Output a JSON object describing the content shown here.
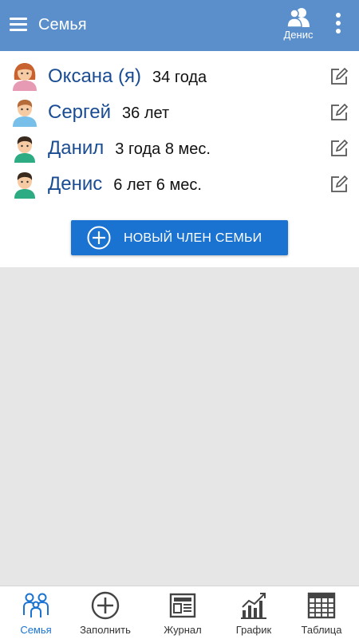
{
  "appbar": {
    "title": "Семья",
    "current_user": "Денис"
  },
  "members": [
    {
      "name": "Оксана (я)",
      "age": "34 года",
      "avatar": "woman-avatar"
    },
    {
      "name": "Сергей",
      "age": "36 лет",
      "avatar": "man-avatar"
    },
    {
      "name": "Данил",
      "age": "3 года 8 мес.",
      "avatar": "boy-avatar"
    },
    {
      "name": "Денис",
      "age": "6 лет 6 мес.",
      "avatar": "boy-avatar"
    }
  ],
  "add_member_label": "НОВЫЙ ЧЛЕН СЕМЬИ",
  "nav": [
    {
      "label": "Семья",
      "icon": "family-icon",
      "active": true
    },
    {
      "label": "Заполнить",
      "icon": "plus-circle-icon"
    },
    {
      "label": "Журнал",
      "icon": "journal-icon"
    },
    {
      "label": "График",
      "icon": "chart-icon"
    },
    {
      "label": "Таблица",
      "icon": "table-icon"
    }
  ],
  "colors": {
    "appbar": "#5b8fcb",
    "accent": "#1a73d0",
    "name": "#1a4c93"
  }
}
